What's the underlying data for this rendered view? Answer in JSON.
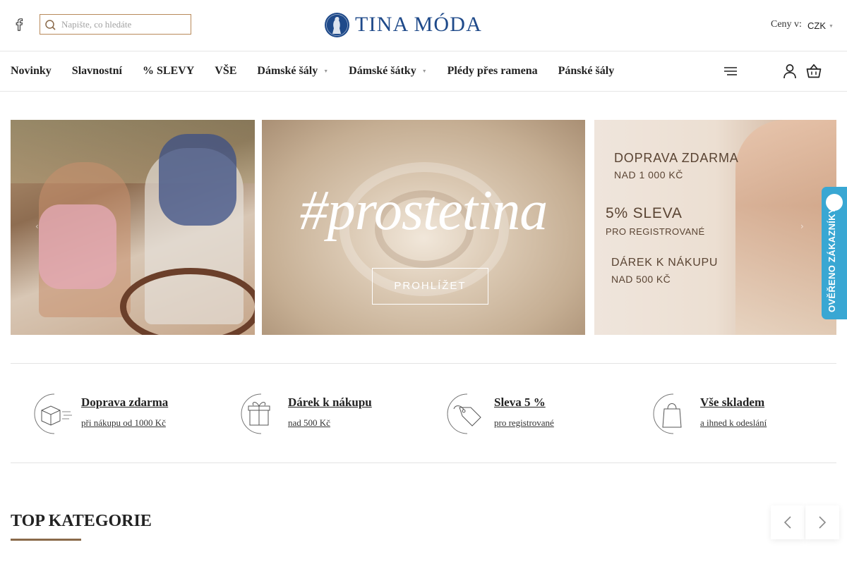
{
  "header": {
    "search_placeholder": "Napište, co hledáte",
    "logo_text": "TINA MÓDA",
    "prices_label": "Ceny v:",
    "currency": "CZK"
  },
  "nav": {
    "items": [
      {
        "label": "Novinky",
        "dropdown": false
      },
      {
        "label": "Slavnostní",
        "dropdown": false
      },
      {
        "label": "% SLEVY",
        "dropdown": false
      },
      {
        "label": "VŠE",
        "dropdown": false
      },
      {
        "label": "Dámské šály",
        "dropdown": true
      },
      {
        "label": "Dámské šátky",
        "dropdown": true
      },
      {
        "label": "Plédy přes ramena",
        "dropdown": false
      },
      {
        "label": "Pánské šály",
        "dropdown": false
      }
    ]
  },
  "banners": {
    "hashtag": "#prostetina",
    "browse_button": "PROHLÍŽET",
    "promo": {
      "line1": "DOPRAVA ZDARMA",
      "line2": "NAD 1 000 KČ",
      "line3": "5% SLEVA",
      "line4": "PRO REGISTROVANÉ",
      "line5": "DÁREK K NÁKUPU",
      "line6": "NAD 500 KČ"
    }
  },
  "verified_badge": "OVĚŘENO ZÁKAZNÍKY",
  "benefits": [
    {
      "icon": "box-icon",
      "title": "Doprava zdarma",
      "subtitle": "při nákupu od 1000 Kč"
    },
    {
      "icon": "gift-icon",
      "title": "Dárek k nákupu",
      "subtitle": "nad 500 Kč"
    },
    {
      "icon": "tag-icon",
      "title": "Sleva 5 %",
      "subtitle": "pro registrované"
    },
    {
      "icon": "shopping-bag-icon",
      "title": "Vše skladem",
      "subtitle": "a ihned k odeslání"
    }
  ],
  "top_categories": {
    "title": "TOP KATEGORIE"
  },
  "colors": {
    "brand_blue": "#1f4a8a",
    "accent_brown": "#8a6a4a",
    "search_border": "#b8895a",
    "verified_blue": "#39a7d3"
  }
}
